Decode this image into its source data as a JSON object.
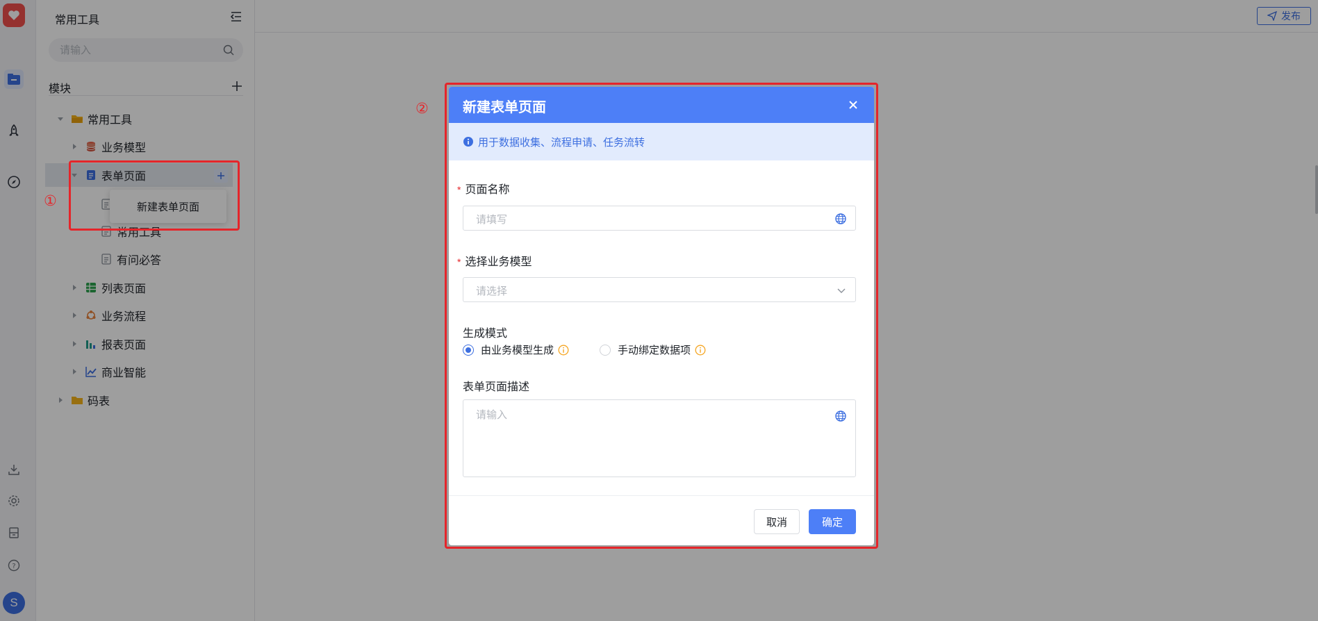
{
  "sidebar": {
    "title": "常用工具",
    "search_placeholder": "请输入",
    "module_label": "模块",
    "tree": {
      "common_tools": "常用工具",
      "business_model": "业务模型",
      "form_page": "表单页面",
      "form_child_hidden": "",
      "form_child_common": "常用工具",
      "form_child_qa": "有问必答",
      "list_page": "列表页面",
      "business_flow": "业务流程",
      "report_page": "报表页面",
      "bi": "商业智能",
      "code_table": "码表"
    },
    "popover_label": "新建表单页面"
  },
  "annotations": {
    "one": "①",
    "two": "②"
  },
  "header": {
    "publish_label": "发布"
  },
  "modal": {
    "title": "新建表单页面",
    "info": "用于数据收集、流程申请、任务流转",
    "page_name_label": "页面名称",
    "page_name_placeholder": "请填写",
    "model_label": "选择业务模型",
    "model_placeholder": "请选择",
    "mode_label": "生成模式",
    "mode_options": [
      "由业务模型生成",
      "手动绑定数据项"
    ],
    "mode_selected": "由业务模型生成",
    "desc_label": "表单页面描述",
    "desc_placeholder": "请输入",
    "required_mark": "*",
    "cancel_label": "取消",
    "ok_label": "确定"
  },
  "colors": {
    "brand_blue": "#4d7ff7",
    "annotation_red": "#e5252a",
    "info_bg": "#e2ebfd",
    "warn_orange": "#f5a623",
    "folder_yellow": "#f5b31b"
  }
}
